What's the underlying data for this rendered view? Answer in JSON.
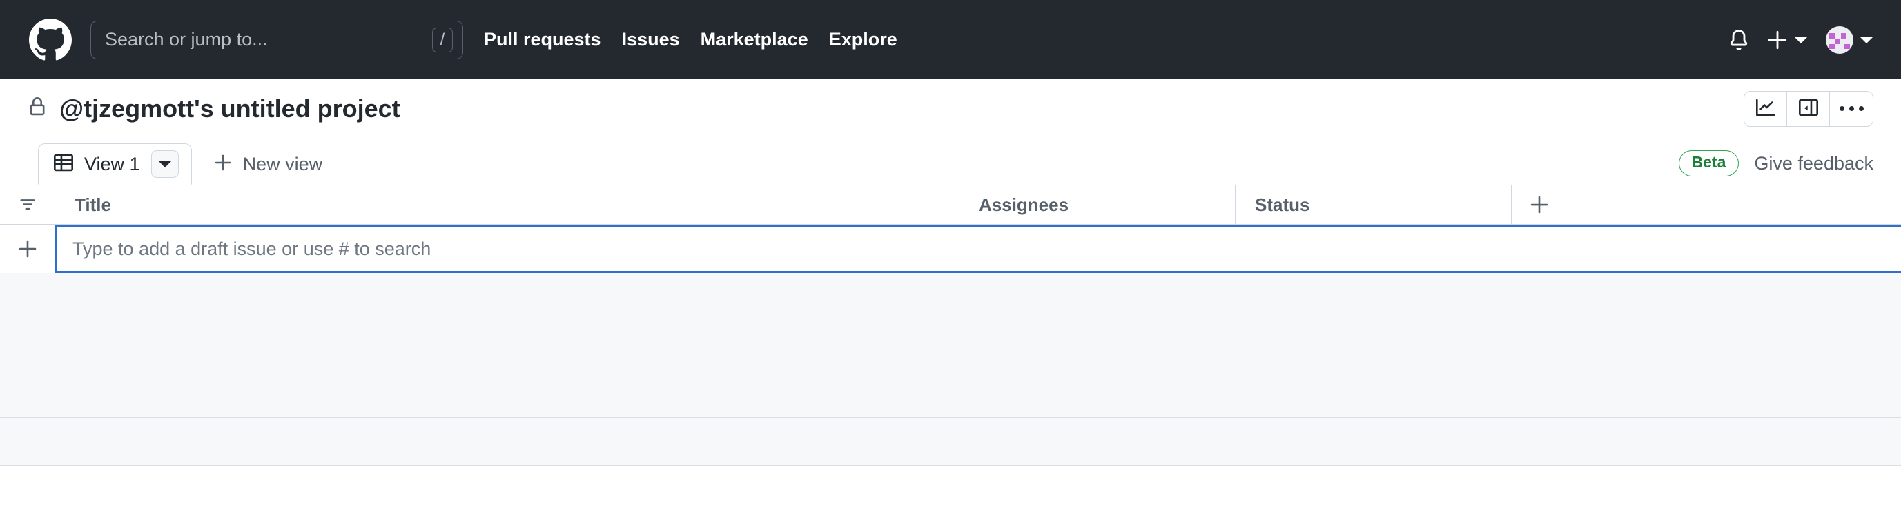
{
  "header": {
    "logo_icon": "github-mark-icon",
    "search": {
      "placeholder": "Search or jump to...",
      "value": "",
      "shortcut_key": "/"
    },
    "nav": [
      {
        "label": "Pull requests"
      },
      {
        "label": "Issues"
      },
      {
        "label": "Marketplace"
      },
      {
        "label": "Explore"
      }
    ],
    "notifications_icon": "bell-icon",
    "create_new_icon": "plus-icon",
    "create_new_caret_icon": "chevron-down-icon",
    "avatar_icon": "user-avatar-identicon",
    "avatar_caret_icon": "chevron-down-icon",
    "background_color": "#24292f"
  },
  "project": {
    "visibility_icon": "lock-icon",
    "title": "@tjzegmott's untitled project",
    "actions": [
      {
        "name": "insights",
        "icon": "line-chart-icon"
      },
      {
        "name": "toggle-sidebar",
        "icon": "side-panel-icon"
      },
      {
        "name": "more-options",
        "icon": "kebab-horizontal-icon"
      }
    ]
  },
  "views": {
    "tabs": [
      {
        "label": "View 1",
        "icon": "table-view-icon",
        "active": true,
        "menu_icon": "triangle-down-icon"
      }
    ],
    "new_view": {
      "label": "New view",
      "icon": "plus-icon"
    },
    "beta_badge": "Beta",
    "feedback_link": "Give feedback",
    "beta_color": "#2da44e"
  },
  "table": {
    "row_gutter_icon": "filter-sort-icon",
    "columns": [
      {
        "label": "Title"
      },
      {
        "label": "Assignees"
      },
      {
        "label": "Status"
      }
    ],
    "add_column_icon": "plus-icon",
    "draft_row": {
      "add_icon": "plus-icon",
      "placeholder": "Type to add a draft issue or use # to search",
      "value": "",
      "focused": true,
      "focus_color": "#2f6fd0"
    },
    "empty_rows": [
      1,
      2,
      3,
      4
    ],
    "empty_row_color": "#f6f8fa"
  }
}
